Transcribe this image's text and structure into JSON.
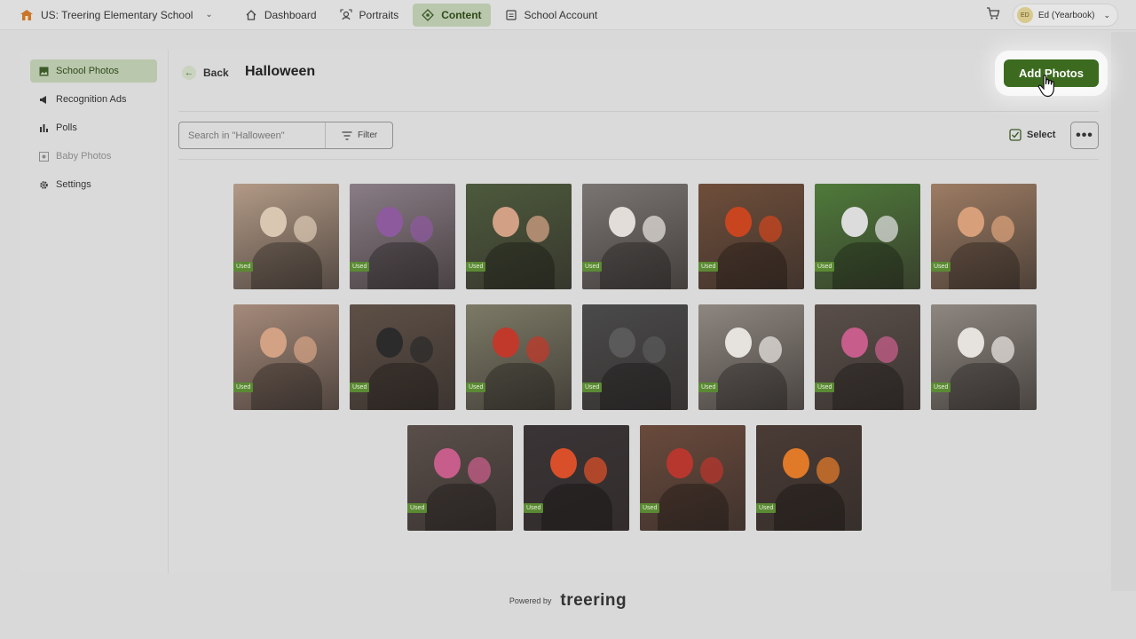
{
  "topbar": {
    "school": "US: Treering Elementary School",
    "nav": [
      {
        "label": "Dashboard",
        "icon": "home-icon"
      },
      {
        "label": "Portraits",
        "icon": "portraits-icon"
      },
      {
        "label": "Content",
        "icon": "content-icon",
        "active": true
      },
      {
        "label": "School Account",
        "icon": "school-account-icon"
      }
    ],
    "user_initials": "ED",
    "user": "Ed (Yearbook)"
  },
  "sidebar": {
    "items": [
      {
        "label": "School Photos",
        "icon": "photo-icon",
        "active": true
      },
      {
        "label": "Recognition Ads",
        "icon": "megaphone-icon"
      },
      {
        "label": "Polls",
        "icon": "bar-chart-icon"
      },
      {
        "label": "Baby Photos",
        "icon": "baby-photo-icon",
        "disabled": true
      },
      {
        "label": "Settings",
        "icon": "gear-icon"
      }
    ]
  },
  "header": {
    "back_label": "Back",
    "title": "Halloween",
    "add_photos_label": "Add Photos"
  },
  "toolbar": {
    "search_placeholder": "Search in \"Halloween\"",
    "filter_label": "Filter",
    "select_label": "Select",
    "more_label": "•••"
  },
  "photos": {
    "badge": "Used",
    "items": [
      {
        "color": "#b29a86",
        "face": "#d9c7b2"
      },
      {
        "color": "#8a7d86",
        "face": "#8d5a9e"
      },
      {
        "color": "#4d5a3c",
        "face": "#d2a084"
      },
      {
        "color": "#7a7572",
        "face": "#e2ddd8"
      },
      {
        "color": "#6f4e3a",
        "face": "#c9451f"
      },
      {
        "color": "#4f7a3a",
        "face": "#dcdcdc"
      },
      {
        "color": "#9d7c63",
        "face": "#d8a07a"
      },
      {
        "color": "#a58a7a",
        "face": "#d3a184"
      },
      {
        "color": "#5e5046",
        "face": "#2b2b2b"
      },
      {
        "color": "#7c7a66",
        "face": "#c0392b"
      },
      {
        "color": "#4a4a4a",
        "face": "#5a5a5a"
      },
      {
        "color": "#8e8780",
        "face": "#e6e2de"
      },
      {
        "color": "#5a4f4a",
        "face": "#c75d8a"
      },
      {
        "color": "#8e8780",
        "face": "#e6e2de"
      },
      {
        "color": "#5a4f4a",
        "face": "#c75d8a"
      },
      {
        "color": "#3a3436",
        "face": "#d94f2a"
      },
      {
        "color": "#6a4a3c",
        "face": "#b7372e"
      },
      {
        "color": "#4a3b35",
        "face": "#e07a28"
      }
    ]
  },
  "footer": {
    "powered_by": "Powered by",
    "brand": "treering"
  }
}
